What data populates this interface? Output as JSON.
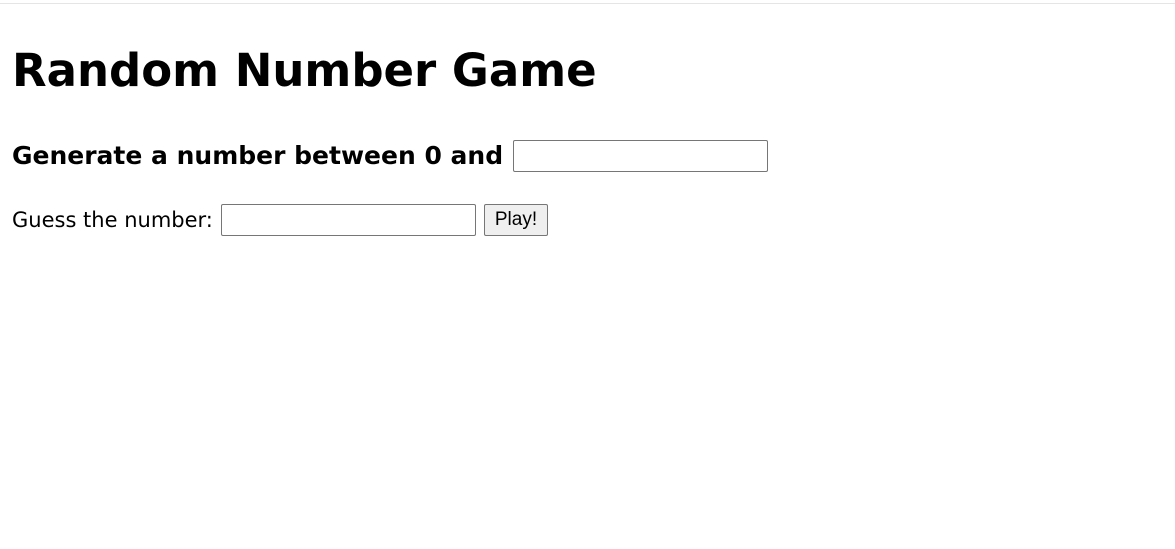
{
  "page": {
    "title": "Random Number Game"
  },
  "range": {
    "label": "Generate a number between 0 and",
    "max_value": "",
    "max_placeholder": ""
  },
  "guess": {
    "label": "Guess the number:",
    "value": "",
    "placeholder": "",
    "play_label": "Play!"
  }
}
